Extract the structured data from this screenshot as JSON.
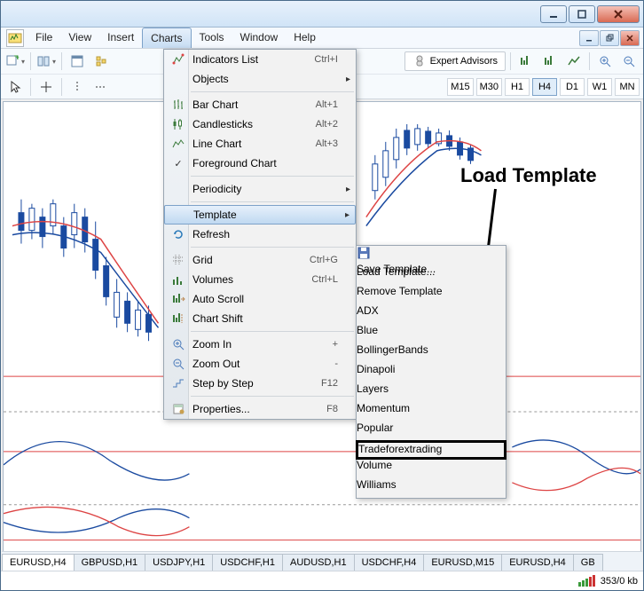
{
  "menubar": {
    "items": [
      "File",
      "View",
      "Insert",
      "Charts",
      "Tools",
      "Window",
      "Help"
    ],
    "active_index": 3
  },
  "toolbar_top": {
    "expert_advisors_label": "Expert Advisors"
  },
  "timeframes": {
    "items": [
      "M15",
      "M30",
      "H1",
      "H4",
      "D1",
      "W1",
      "MN"
    ],
    "active": "H4"
  },
  "charts_menu": {
    "items": [
      {
        "icon": "indicators-icon",
        "label": "Indicators List",
        "shortcut": "Ctrl+I"
      },
      {
        "icon": "",
        "label": "Objects",
        "shortcut": "",
        "submenu": true
      },
      {
        "sep": true
      },
      {
        "icon": "barchart-icon",
        "label": "Bar Chart",
        "shortcut": "Alt+1"
      },
      {
        "icon": "candlestick-icon",
        "label": "Candlesticks",
        "shortcut": "Alt+2"
      },
      {
        "icon": "linechart-icon",
        "label": "Line Chart",
        "shortcut": "Alt+3"
      },
      {
        "icon": "check",
        "label": "Foreground Chart",
        "shortcut": ""
      },
      {
        "sep": true
      },
      {
        "icon": "",
        "label": "Periodicity",
        "shortcut": "",
        "submenu": true
      },
      {
        "sep": true
      },
      {
        "icon": "",
        "label": "Template",
        "shortcut": "",
        "submenu": true,
        "selected": true
      },
      {
        "icon": "refresh-icon",
        "label": "Refresh",
        "shortcut": ""
      },
      {
        "sep": true
      },
      {
        "icon": "grid-icon",
        "label": "Grid",
        "shortcut": "Ctrl+G"
      },
      {
        "icon": "volumes-icon",
        "label": "Volumes",
        "shortcut": "Ctrl+L"
      },
      {
        "icon": "autoscroll-icon",
        "label": "Auto Scroll",
        "shortcut": ""
      },
      {
        "icon": "chartshift-icon",
        "label": "Chart Shift",
        "shortcut": ""
      },
      {
        "sep": true
      },
      {
        "icon": "zoomin-icon",
        "label": "Zoom In",
        "shortcut": "+"
      },
      {
        "icon": "zoomout-icon",
        "label": "Zoom Out",
        "shortcut": "-"
      },
      {
        "icon": "stepbystep-icon",
        "label": "Step by Step",
        "shortcut": "F12"
      },
      {
        "sep": true
      },
      {
        "icon": "properties-icon",
        "label": "Properties...",
        "shortcut": "F8"
      }
    ]
  },
  "template_submenu": {
    "header": [
      {
        "icon": "save-template-icon",
        "label": "Save Template..."
      },
      {
        "icon": "",
        "label": "Load Template..."
      },
      {
        "icon": "",
        "label": "Remove Template",
        "submenu": true
      }
    ],
    "templates": [
      "ADX",
      "Blue",
      "BollingerBands",
      "Dinapoli",
      "Layers",
      "Momentum",
      "Popular",
      "Tradeforextrading",
      "Volume",
      "Williams"
    ],
    "highlighted_index": 7
  },
  "annotation": {
    "label": "Load Template"
  },
  "tabs": {
    "items": [
      "EURUSD,H4",
      "GBPUSD,H1",
      "USDJPY,H1",
      "USDCHF,H1",
      "AUDUSD,H1",
      "USDCHF,H4",
      "EURUSD,M15",
      "EURUSD,H4",
      "GB"
    ],
    "active_index": 0
  },
  "statusbar": {
    "connection": "353/0 kb"
  }
}
